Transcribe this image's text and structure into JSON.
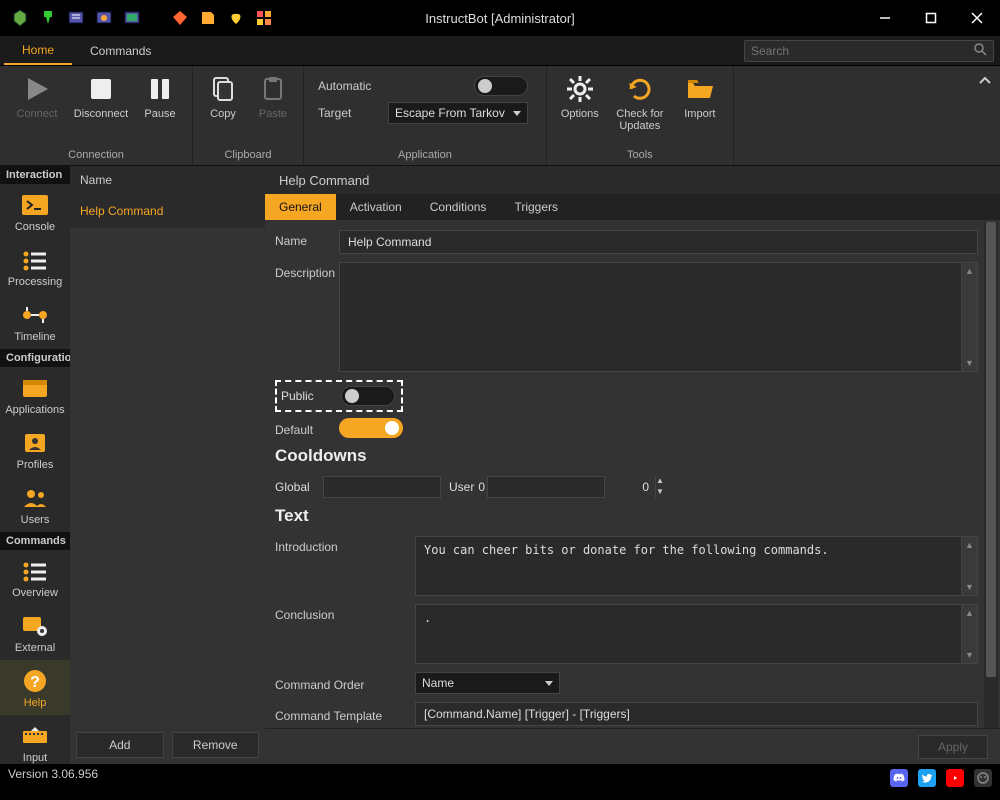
{
  "window": {
    "title": "InstructBot [Administrator]"
  },
  "tabs": {
    "home": "Home",
    "commands": "Commands"
  },
  "search": {
    "placeholder": "Search"
  },
  "ribbon": {
    "connect": "Connect",
    "disconnect": "Disconnect",
    "pause": "Pause",
    "copy": "Copy",
    "paste": "Paste",
    "connection_group": "Connection",
    "clipboard_group": "Clipboard",
    "automatic_label": "Automatic",
    "automatic_on": false,
    "target_label": "Target",
    "target_value": "Escape From Tarkov",
    "application_group": "Application",
    "options": "Options",
    "check_updates": "Check for Updates",
    "import": "Import",
    "tools_group": "Tools"
  },
  "leftbar": {
    "interaction": "Interaction",
    "console": "Console",
    "processing": "Processing",
    "timeline": "Timeline",
    "configuration": "Configuration",
    "applications": "Applications",
    "profiles": "Profiles",
    "users": "Users",
    "commands": "Commands",
    "overview": "Overview",
    "external": "External",
    "help": "Help",
    "input": "Input"
  },
  "cmdlist": {
    "header": "Name",
    "items": [
      "Help Command"
    ],
    "add": "Add",
    "remove": "Remove"
  },
  "editor": {
    "title": "Help Command",
    "tabs": {
      "general": "General",
      "activation": "Activation",
      "conditions": "Conditions",
      "triggers": "Triggers"
    },
    "name_label": "Name",
    "name_value": "Help Command",
    "description_label": "Description",
    "description_value": "",
    "public_label": "Public",
    "public_on": false,
    "default_label": "Default",
    "default_on": true,
    "cooldowns_title": "Cooldowns",
    "global_label": "Global",
    "global_value": "0",
    "user_label": "User",
    "user_value": "0",
    "text_title": "Text",
    "introduction_label": "Introduction",
    "introduction_value": "You can cheer bits or donate for the following commands.",
    "conclusion_label": "Conclusion",
    "conclusion_value": ".",
    "command_order_label": "Command Order",
    "command_order_value": "Name",
    "command_template_label": "Command Template",
    "command_template_value": "[Command.Name] [Trigger] - [Triggers]",
    "apply": "Apply"
  },
  "status": {
    "version": "Version 3.06.956"
  }
}
